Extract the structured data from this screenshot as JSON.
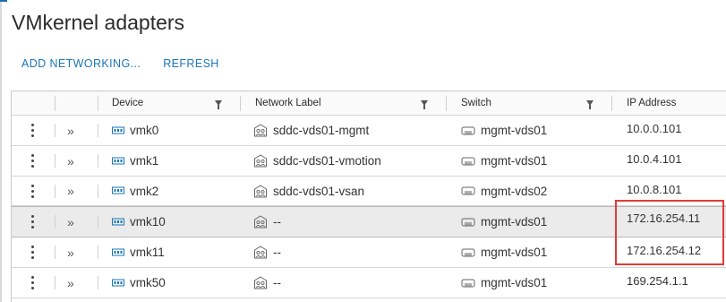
{
  "page": {
    "title": "VMkernel adapters"
  },
  "toolbar": {
    "add_networking": "ADD NETWORKING...",
    "refresh": "REFRESH"
  },
  "columns": {
    "device": "Device",
    "network_label": "Network Label",
    "switch": "Switch",
    "ip_address": "IP Address"
  },
  "rows": [
    {
      "device": "vmk0",
      "network_label": "sddc-vds01-mgmt",
      "switch": "mgmt-vds01",
      "ip": "10.0.0.101",
      "selected": false
    },
    {
      "device": "vmk1",
      "network_label": "sddc-vds01-vmotion",
      "switch": "mgmt-vds01",
      "ip": "10.0.4.101",
      "selected": false
    },
    {
      "device": "vmk2",
      "network_label": "sddc-vds01-vsan",
      "switch": "mgmt-vds02",
      "ip": "10.0.8.101",
      "selected": false
    },
    {
      "device": "vmk10",
      "network_label": "--",
      "switch": "mgmt-vds01",
      "ip": "172.16.254.11",
      "selected": true
    },
    {
      "device": "vmk11",
      "network_label": "--",
      "switch": "mgmt-vds01",
      "ip": "172.16.254.12",
      "selected": false
    },
    {
      "device": "vmk50",
      "network_label": "--",
      "switch": "mgmt-vds01",
      "ip": "169.254.1.1",
      "selected": false
    }
  ],
  "icons": {
    "row_actions": "kebab-icon",
    "expand": "double-chevron-icon",
    "device": "vmkernel-nic-icon",
    "network": "port-group-icon",
    "switch": "switch-icon",
    "filter": "filter-icon"
  },
  "colors": {
    "link": "#1a76b8",
    "highlight": "#e23a3a",
    "selected_row": "#ebebeb"
  }
}
